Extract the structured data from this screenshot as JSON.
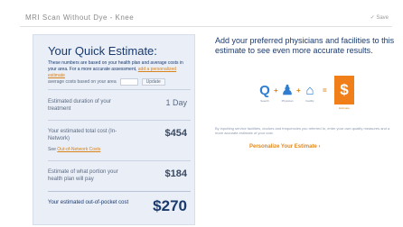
{
  "window": {
    "title": "MRI Scan Without Dye - Knee",
    "right_label": "✓ Save"
  },
  "estimate": {
    "title": "Your Quick Estimate:",
    "description": "These numbers are based on your health plan and average costs in your area. For a more accurate assessment,",
    "description_link": "add a personalized estimate",
    "avg_label": "average costs based on your area",
    "zip_value": "",
    "zip_button": "Update",
    "rows": [
      {
        "label": "Estimated duration of your treatment",
        "value": "1 Day"
      },
      {
        "label": "Your estimated total cost (In-Network)",
        "value": "$454",
        "sub_prefix": "See",
        "sub_link": "Out-of-Network Costs"
      },
      {
        "label": "Estimate of what portion your health plan will pay",
        "value": "$184"
      }
    ],
    "total_label": "Your estimated out-of-pocket cost",
    "total_value": "$270"
  },
  "promo": {
    "title": "Add your preferred physicians and facilities to this estimate to see even more accurate results.",
    "icons": [
      {
        "name": "search-icon",
        "glyph": "Q",
        "caption": "Search"
      },
      {
        "name": "physician-icon",
        "glyph": "♟",
        "caption": "Physician"
      },
      {
        "name": "facility-icon",
        "glyph": "⌂",
        "caption": "Facility"
      }
    ],
    "dollar": {
      "glyph": "$",
      "caption": "Estimate"
    },
    "plus": "+",
    "equals": "=",
    "description": "By inputting service facilities, doctors and frequencies you referred to, enter your own quality measures and a more accurate estimate of your cost.",
    "cta": "Personalize Your Estimate ›"
  },
  "colors": {
    "brand": "#1a3a6e",
    "accent": "#f07f1a",
    "icon_blue": "#2e7dd1",
    "panel": "#e9eef7"
  }
}
